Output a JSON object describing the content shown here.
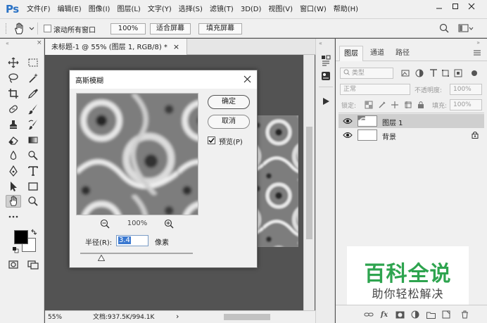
{
  "app": {
    "logo": "Ps",
    "menu": [
      "文件(F)",
      "编辑(E)",
      "图像(I)",
      "图层(L)",
      "文字(Y)",
      "选择(S)",
      "滤镜(T)",
      "3D(D)",
      "视图(V)",
      "窗口(W)",
      "帮助(H)"
    ]
  },
  "options_bar": {
    "scroll_all_windows_label": "滚动所有窗口",
    "zoom_100_label": "100%",
    "fit_screen_label": "适合屏幕",
    "fill_screen_label": "填充屏幕"
  },
  "document": {
    "tab_title": "未标题-1 @ 55% (图层 1, RGB/8) *",
    "tab_close": "×",
    "zoom": "55%",
    "doc_info": "文档:937.5K/994.1K",
    "scroll_arrow": "›"
  },
  "panels": {
    "tabs": [
      "图层",
      "通道",
      "路径"
    ],
    "filter_kind": "类型",
    "blend_mode": "正常",
    "opacity_label": "不透明度:",
    "opacity_value": "100%",
    "lock_label": "锁定:",
    "fill_label": "填充:",
    "fill_value": "100%",
    "layers": [
      {
        "name": "图层 1"
      },
      {
        "name": "背景"
      }
    ]
  },
  "dialog": {
    "title": "高斯模糊",
    "ok_label": "确定",
    "cancel_label": "取消",
    "preview_label": "预览(P)",
    "preview_checked": true,
    "zoom": "100%",
    "radius_label": "半径(R):",
    "radius_value": "3.4",
    "radius_unit": "像素"
  },
  "watermark": {
    "main": "百科全说",
    "sub": "助你轻松解决"
  },
  "colors": {
    "ps_blue": "#2a72c5",
    "watermark_green": "#2ea44f",
    "selection_blue": "#3a78d0"
  }
}
